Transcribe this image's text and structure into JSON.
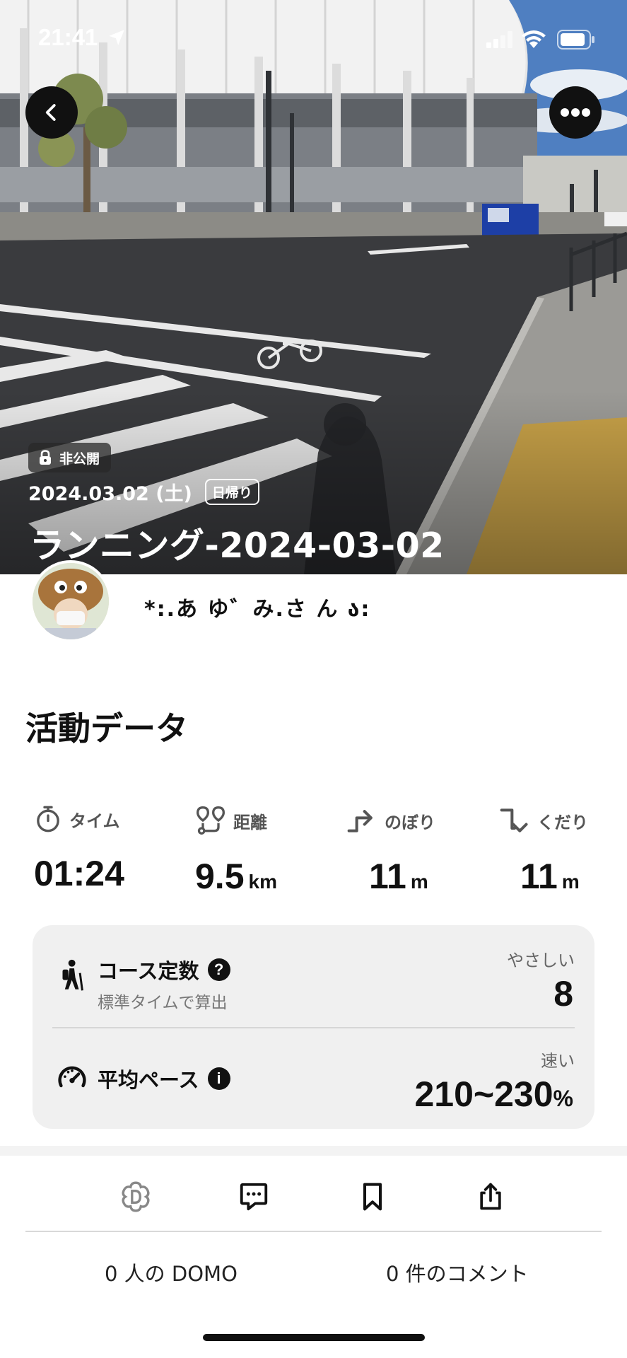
{
  "status_bar": {
    "time": "21:41"
  },
  "hero": {
    "privacy_label": "非公開",
    "date": "2024.03.02 (土)",
    "trip_tag": "日帰り",
    "title": "ランニング-2024-03-02"
  },
  "user": {
    "name": "*:.あ ゆ゛み.さ ん ა:"
  },
  "section_title": "活動データ",
  "stats": [
    {
      "label": "タイム",
      "value": "01:24",
      "unit": ""
    },
    {
      "label": "距離",
      "value": "9.5",
      "unit": "km"
    },
    {
      "label": "のぼり",
      "value": "11",
      "unit": "m"
    },
    {
      "label": "くだり",
      "value": "11",
      "unit": "m"
    }
  ],
  "course_constant": {
    "label": "コース定数",
    "sublabel": "標準タイムで算出",
    "rank": "やさしい",
    "value": "8"
  },
  "average_pace": {
    "label": "平均ペース",
    "rank": "速い",
    "value": "210~230",
    "unit": "%"
  },
  "actions": {
    "domo_count": "0 人の DOMO",
    "comment_count": "0 件のコメント"
  },
  "colors": {
    "accent_dark": "#111111",
    "card_bg": "#f0f0f0",
    "muted": "#777777"
  }
}
